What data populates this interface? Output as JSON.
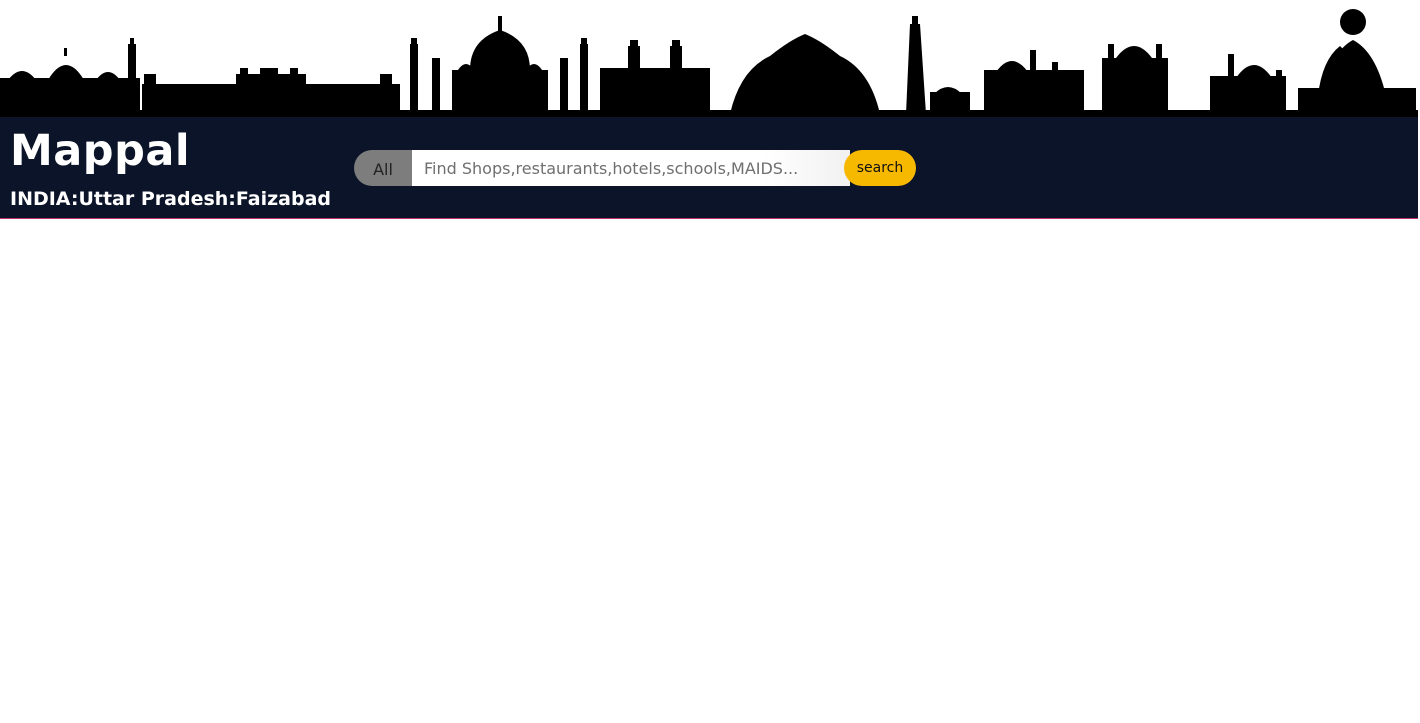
{
  "banner": {
    "skyline_icon": "india-monuments-skyline",
    "color": "#000000"
  },
  "header": {
    "brand": "Mappal",
    "location": "INDIA:Uttar Pradesh:Faizabad",
    "background": "#0b1428"
  },
  "search": {
    "scope_label": "All",
    "placeholder": "Find Shops,restaurants,hotels,schools,MAIDS...",
    "value": "",
    "button_label": "search",
    "button_color": "#f7b800"
  }
}
